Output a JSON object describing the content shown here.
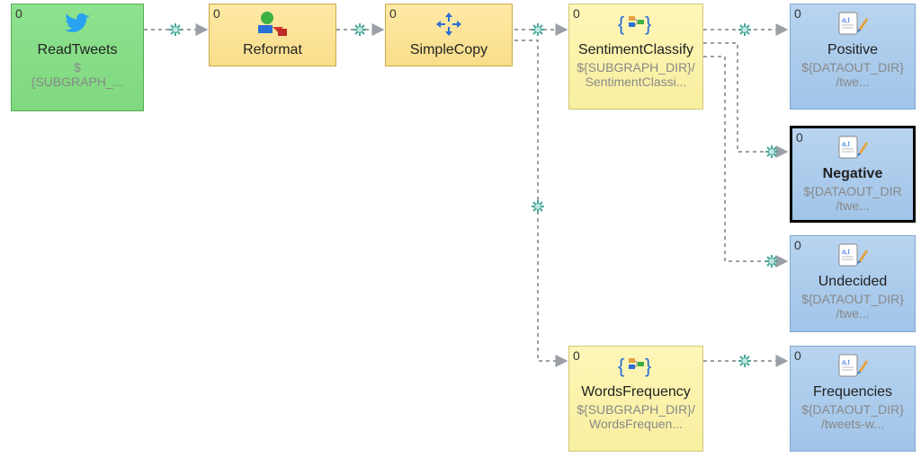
{
  "nodes": {
    "readTweets": {
      "count": "0",
      "label": "ReadTweets",
      "sublabel": "$\n{SUBGRAPH_..."
    },
    "reformat": {
      "count": "0",
      "label": "Reformat",
      "sublabel": ""
    },
    "simpleCopy": {
      "count": "0",
      "label": "SimpleCopy",
      "sublabel": ""
    },
    "sentimentClassify": {
      "count": "0",
      "label": "SentimentClassify",
      "sublabel": "${SUBGRAPH_DIR}/\nSentimentClassi..."
    },
    "wordsFrequency": {
      "count": "0",
      "label": "WordsFrequency",
      "sublabel": "${SUBGRAPH_DIR}/\nWordsFrequen..."
    },
    "positive": {
      "count": "0",
      "label": "Positive",
      "sublabel": "${DATAOUT_DIR}\n/twe..."
    },
    "negative": {
      "count": "0",
      "label": "Negative",
      "sublabel": "${DATAOUT_DIR\n/twe..."
    },
    "undecided": {
      "count": "0",
      "label": "Undecided",
      "sublabel": "${DATAOUT_DIR}\n/twe..."
    },
    "frequencies": {
      "count": "0",
      "label": "Frequencies",
      "sublabel": "${DATAOUT_DIR}\n/tweets-w..."
    }
  },
  "colors": {
    "green": "#8ee28e",
    "orange": "#f8dd8a",
    "yellow": "#f8efa0",
    "blue": "#a0c4e8",
    "edgeGray": "#9aa0a6",
    "portTeal": "#4aa89a"
  }
}
